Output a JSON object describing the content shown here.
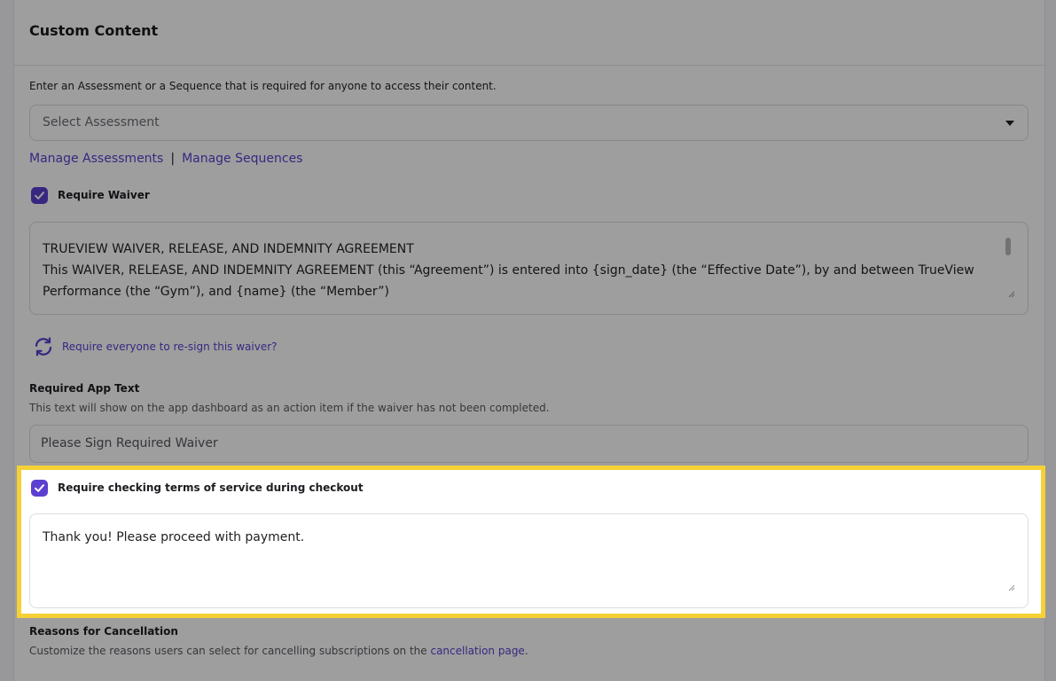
{
  "panel": {
    "title": "Custom Content",
    "assessment_description": "Enter an Assessment or a Sequence that is required for anyone to access their content.",
    "assessment_select": {
      "placeholder": "Select Assessment"
    },
    "links": {
      "manage_assessments": "Manage Assessments",
      "separator": "|",
      "manage_sequences": "Manage Sequences"
    },
    "require_waiver": {
      "label": "Require Waiver",
      "checked": true
    },
    "waiver_text": {
      "line1": "TRUEVIEW WAIVER, RELEASE, AND INDEMNITY AGREEMENT",
      "line2": "This WAIVER, RELEASE, AND INDEMNITY AGREEMENT (this “Agreement”) is entered into {sign_date} (the “Effective Date”), by and between TrueView Performance (the “Gym”), and {name} (the “Member”)"
    },
    "resign": {
      "label": "Require everyone to re-sign this waiver?",
      "icon": "refresh-icon"
    },
    "required_app_text": {
      "title": "Required App Text",
      "help": "This text will show on the app dashboard as an action item if the waiver has not been completed.",
      "value": "Please Sign Required Waiver"
    },
    "require_tos": {
      "label": "Require checking terms of service during checkout",
      "checked": true,
      "text": "Thank you! Please proceed with payment."
    },
    "cancellation": {
      "title": "Reasons for Cancellation",
      "help_prefix": "Customize the reasons users can select for cancelling subscriptions on the ",
      "help_link": "cancellation page",
      "help_suffix": "."
    }
  },
  "colors": {
    "accent": "#5b3fd1",
    "highlight": "#f5d135"
  }
}
